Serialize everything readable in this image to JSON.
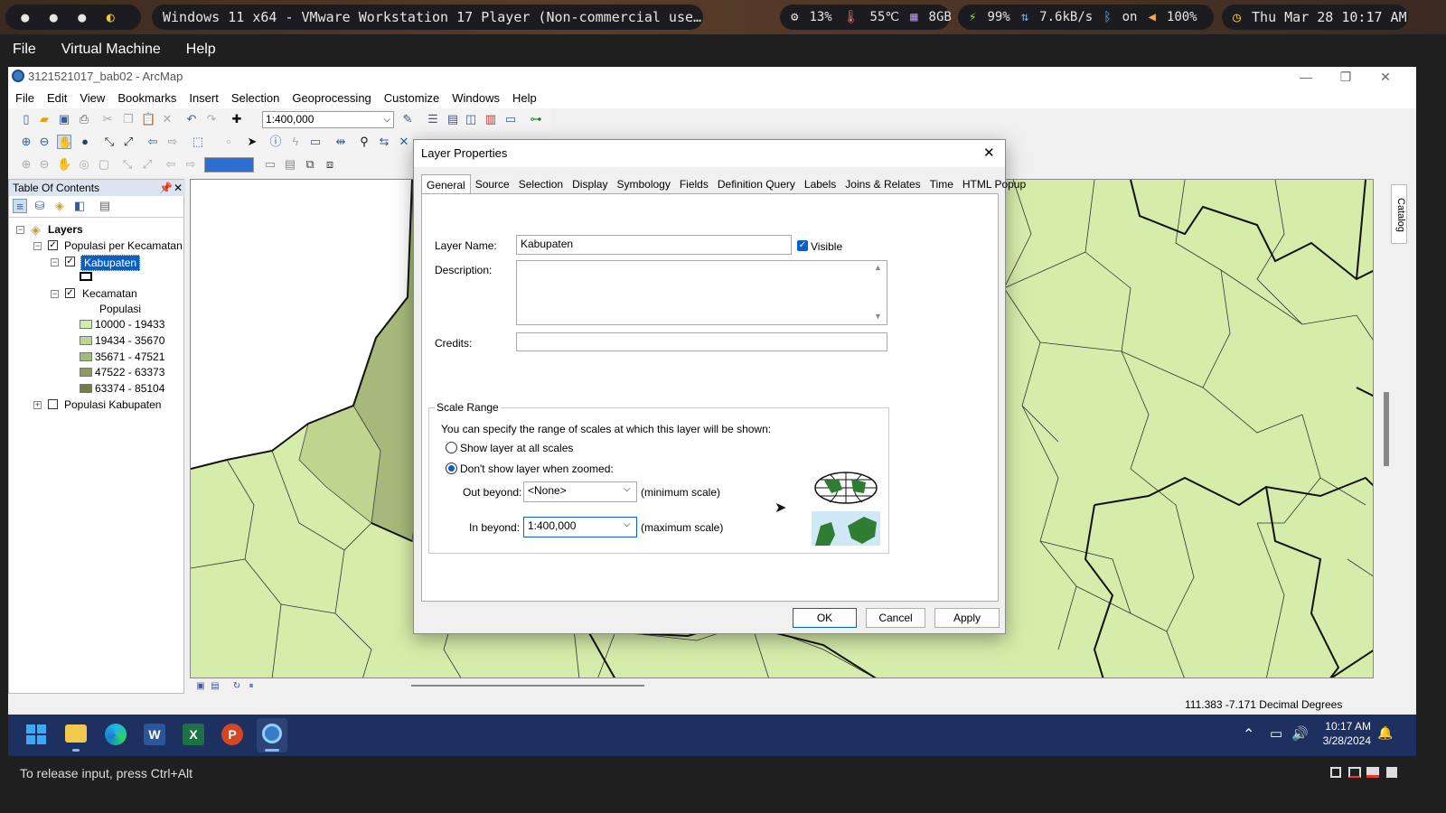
{
  "host_bar": {
    "window_title": "Windows 11 x64 - VMware Workstation 17 Player (Non-commercial use…",
    "cpu": "13%",
    "temp": "55℃",
    "mem": "8GB",
    "battery": "99%",
    "net": "7.6kB/s",
    "bluetooth": "on",
    "volume": "100%",
    "datetime": "Thu Mar 28 10:17 AM"
  },
  "vm_menu": [
    "File",
    "Virtual Machine",
    "Help"
  ],
  "arcmap": {
    "title": "3121521017_bab02 - ArcMap",
    "menu": [
      "File",
      "Edit",
      "View",
      "Bookmarks",
      "Insert",
      "Selection",
      "Geoprocessing",
      "Customize",
      "Windows",
      "Help"
    ],
    "scale": "1:400,000",
    "toc": {
      "title": "Table Of Contents",
      "layers_root": "Layers",
      "group1": "Populasi per Kecamatan",
      "layer_kabupaten": "Kabupaten",
      "layer_kecamatan": "Kecamatan",
      "field_name": "Populasi",
      "classes": [
        "10000 - 19433",
        "19434 - 35670",
        "35671 - 47521",
        "47522 - 63373",
        "63374 - 85104"
      ],
      "class_colors": [
        "#d6ecaa",
        "#bfd48f",
        "#a6b97a",
        "#8c9c5e",
        "#6f7f45"
      ],
      "group2": "Populasi Kabupaten"
    },
    "status_coords": "111.383  -7.171 Decimal Degrees",
    "catalog_tab": "Catalog"
  },
  "dialog": {
    "title": "Layer Properties",
    "tabs": [
      "General",
      "Source",
      "Selection",
      "Display",
      "Symbology",
      "Fields",
      "Definition Query",
      "Labels",
      "Joins & Relates",
      "Time",
      "HTML Popup"
    ],
    "layer_name_label": "Layer Name:",
    "layer_name_value": "Kabupaten",
    "visible_label": "Visible",
    "description_label": "Description:",
    "credits_label": "Credits:",
    "scale_range_title": "Scale Range",
    "scale_range_text": "You can specify the range of scales at which this layer will be shown:",
    "radio_all": "Show layer at all scales",
    "radio_zoomed": "Don't show layer when zoomed:",
    "out_beyond_label": "Out beyond:",
    "out_beyond_value": "<None>",
    "min_scale": "(minimum scale)",
    "in_beyond_label": "In beyond:",
    "in_beyond_value": "1:400,000",
    "max_scale": "(maximum scale)",
    "ok": "OK",
    "cancel": "Cancel",
    "apply": "Apply"
  },
  "taskbar": {
    "time": "10:17 AM",
    "date": "3/28/2024"
  },
  "vm_status": "To release input, press Ctrl+Alt"
}
